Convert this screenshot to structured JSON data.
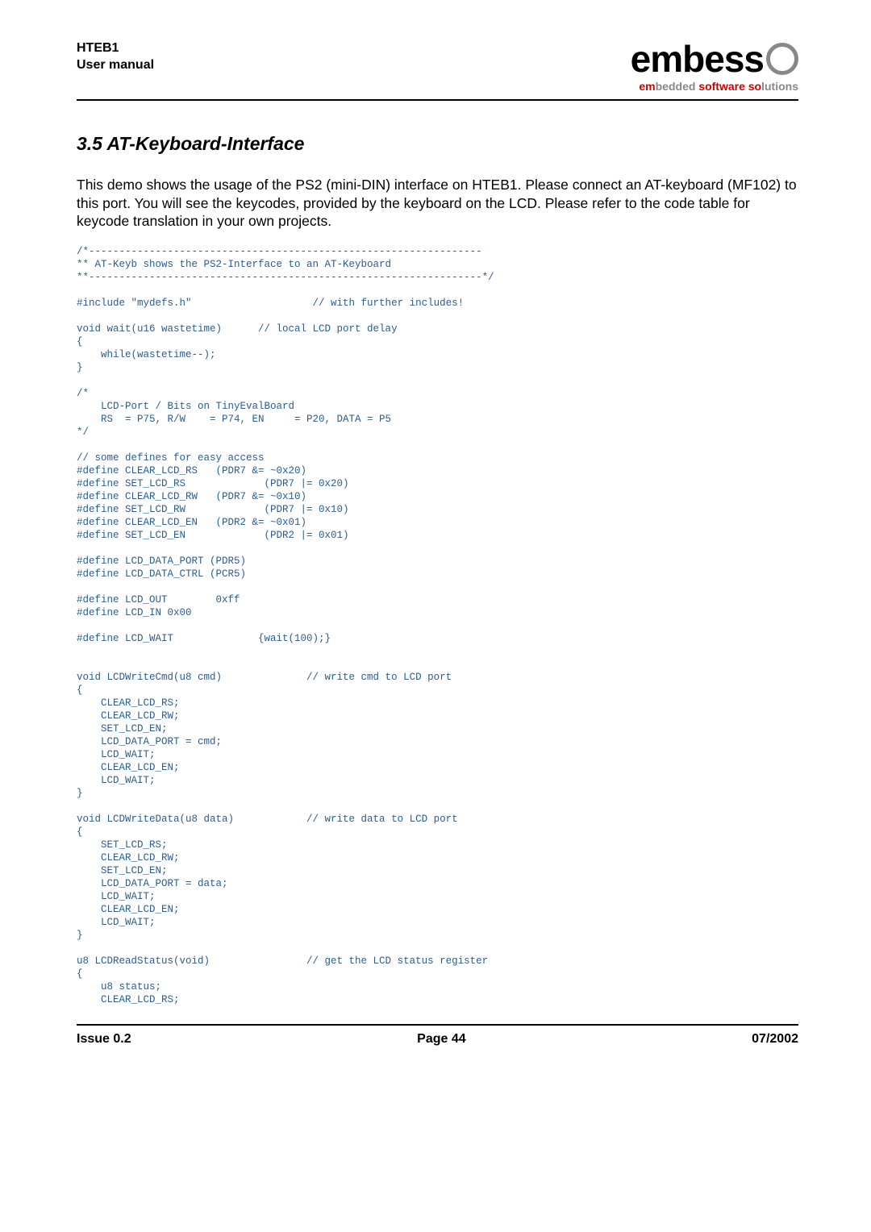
{
  "header": {
    "line1": "HTEB1",
    "line2": "User manual"
  },
  "logo": {
    "name": "embess",
    "tag_em": "em",
    "tag_bedded": "bedded ",
    "tag_software": "software ",
    "tag_so": "so",
    "tag_lutions": "lutions"
  },
  "section_title": "3.5 AT-Keyboard-Interface",
  "intro": "This demo shows the usage of the PS2 (mini-DIN) interface on HTEB1. Please connect an AT-keyboard (MF102) to this port. You will see the keycodes, provided by the keyboard on the LCD. Please refer to the code table for keycode translation in your own projects.",
  "code": "/*-----------------------------------------------------------------\n** AT-Keyb shows the PS2-Interface to an AT-Keyboard\n**-----------------------------------------------------------------*/\n\n#include \"mydefs.h\"                    // with further includes!\n\nvoid wait(u16 wastetime)      // local LCD port delay\n{\n    while(wastetime--);\n}\n\n/*\n    LCD-Port / Bits on TinyEvalBoard\n    RS  = P75, R/W    = P74, EN     = P20, DATA = P5\n*/\n\n// some defines for easy access\n#define CLEAR_LCD_RS   (PDR7 &= ~0x20)\n#define SET_LCD_RS             (PDR7 |= 0x20)\n#define CLEAR_LCD_RW   (PDR7 &= ~0x10)\n#define SET_LCD_RW             (PDR7 |= 0x10)\n#define CLEAR_LCD_EN   (PDR2 &= ~0x01)\n#define SET_LCD_EN             (PDR2 |= 0x01)\n\n#define LCD_DATA_PORT (PDR5)\n#define LCD_DATA_CTRL (PCR5)\n\n#define LCD_OUT        0xff\n#define LCD_IN 0x00\n\n#define LCD_WAIT              {wait(100);}\n\n\nvoid LCDWriteCmd(u8 cmd)              // write cmd to LCD port\n{\n    CLEAR_LCD_RS;\n    CLEAR_LCD_RW;\n    SET_LCD_EN;\n    LCD_DATA_PORT = cmd;\n    LCD_WAIT;\n    CLEAR_LCD_EN;\n    LCD_WAIT;\n}\n\nvoid LCDWriteData(u8 data)            // write data to LCD port\n{\n    SET_LCD_RS;\n    CLEAR_LCD_RW;\n    SET_LCD_EN;\n    LCD_DATA_PORT = data;\n    LCD_WAIT;\n    CLEAR_LCD_EN;\n    LCD_WAIT;\n}\n\nu8 LCDReadStatus(void)                // get the LCD status register\n{\n    u8 status;\n    CLEAR_LCD_RS;",
  "footer": {
    "left": "Issue 0.2",
    "center": "Page 44",
    "right": "07/2002"
  }
}
